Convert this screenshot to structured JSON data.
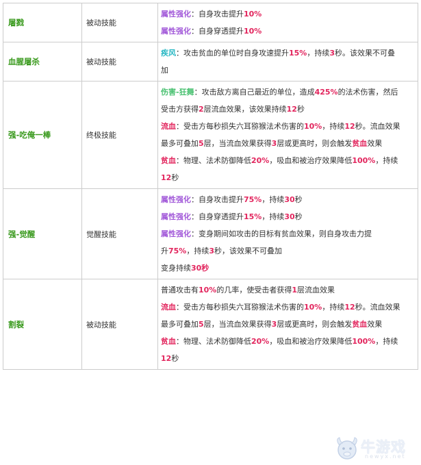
{
  "rows": [
    {
      "name": "屠戮",
      "type": "被动技能",
      "lines": [
        [
          {
            "t": "属性强化",
            "c": "k-purple"
          },
          {
            "t": "：自身攻击提升"
          },
          {
            "t": "10%",
            "c": "n"
          }
        ],
        [
          {
            "t": "属性强化",
            "c": "k-purple"
          },
          {
            "t": "：自身穿透提升"
          },
          {
            "t": "10%",
            "c": "n"
          }
        ]
      ]
    },
    {
      "name": "血腥屠杀",
      "type": "被动技能",
      "lines": [
        [
          {
            "t": "疾风",
            "c": "k-cyan"
          },
          {
            "t": "：攻击贫血的单位时自身攻速提升"
          },
          {
            "t": "15%",
            "c": "n"
          },
          {
            "t": "，持续"
          },
          {
            "t": "3",
            "c": "n"
          },
          {
            "t": "秒。该效果不可叠"
          }
        ],
        [
          {
            "t": "加"
          }
        ]
      ]
    },
    {
      "name": "强-吃俺一棒",
      "type": "终极技能",
      "lines": [
        [
          {
            "t": "伤害-狂舞",
            "c": "k-green"
          },
          {
            "t": "：攻击敌方离自己最近的单位，造成"
          },
          {
            "t": "425%",
            "c": "n"
          },
          {
            "t": "的法术伤害，然后"
          }
        ],
        [
          {
            "t": "受击方获得"
          },
          {
            "t": "2",
            "c": "n"
          },
          {
            "t": "层流血效果，该效果持续"
          },
          {
            "t": "12",
            "c": "n"
          },
          {
            "t": "秒"
          }
        ],
        [
          {
            "t": "流血",
            "c": "k-red"
          },
          {
            "t": "：受击方每秒损失六耳猕猴法术伤害的"
          },
          {
            "t": "10%",
            "c": "n"
          },
          {
            "t": "，持续"
          },
          {
            "t": "12",
            "c": "n"
          },
          {
            "t": "秒。流血效果"
          }
        ],
        [
          {
            "t": "最多可叠加"
          },
          {
            "t": "5",
            "c": "n"
          },
          {
            "t": "层，当流血效果获得"
          },
          {
            "t": "3",
            "c": "n"
          },
          {
            "t": "层或更高时，则会触发"
          },
          {
            "t": "贫血",
            "c": "k-red"
          },
          {
            "t": "效果"
          }
        ],
        [
          {
            "t": "贫血",
            "c": "k-red"
          },
          {
            "t": "：物理、法术防御降低"
          },
          {
            "t": "20%",
            "c": "n"
          },
          {
            "t": "，吸血和被治疗效果降低"
          },
          {
            "t": "100%",
            "c": "n"
          },
          {
            "t": "，持续"
          }
        ],
        [
          {
            "t": "12",
            "c": "n"
          },
          {
            "t": "秒"
          }
        ]
      ]
    },
    {
      "name": "强-觉醒",
      "type": "觉醒技能",
      "lines": [
        [
          {
            "t": "属性强化",
            "c": "k-purple"
          },
          {
            "t": "：自身攻击提升"
          },
          {
            "t": "75%",
            "c": "n"
          },
          {
            "t": "，持续"
          },
          {
            "t": "30",
            "c": "n"
          },
          {
            "t": "秒"
          }
        ],
        [
          {
            "t": "属性强化",
            "c": "k-purple"
          },
          {
            "t": "：自身穿透提升"
          },
          {
            "t": "15%",
            "c": "n"
          },
          {
            "t": "，持续"
          },
          {
            "t": "30",
            "c": "n"
          },
          {
            "t": "秒"
          }
        ],
        [
          {
            "t": "属性强化",
            "c": "k-purple"
          },
          {
            "t": "：变身期间如攻击的目标有贫血效果，则自身攻击力提"
          }
        ],
        [
          {
            "t": "升"
          },
          {
            "t": "75%",
            "c": "n"
          },
          {
            "t": "，持续"
          },
          {
            "t": "3",
            "c": "n"
          },
          {
            "t": "秒，该效果不可叠加"
          }
        ],
        [
          {
            "t": "变身持续"
          },
          {
            "t": "30秒",
            "c": "n"
          }
        ]
      ]
    },
    {
      "name": "割裂",
      "type": "被动技能",
      "lines": [
        [
          {
            "t": "普通攻击有"
          },
          {
            "t": "10%",
            "c": "n"
          },
          {
            "t": "的几率，使受击者获得"
          },
          {
            "t": "1",
            "c": "n"
          },
          {
            "t": "层流血效果"
          }
        ],
        [
          {
            "t": "流血",
            "c": "k-red"
          },
          {
            "t": "：受击方每秒损失六耳猕猴法术伤害的"
          },
          {
            "t": "10%",
            "c": "n"
          },
          {
            "t": "，持续"
          },
          {
            "t": "12",
            "c": "n"
          },
          {
            "t": "秒。流血效果"
          }
        ],
        [
          {
            "t": "最多可叠加"
          },
          {
            "t": "5",
            "c": "n"
          },
          {
            "t": "层，当流血效果获得"
          },
          {
            "t": "3",
            "c": "n"
          },
          {
            "t": "层或更高时，则会触发"
          },
          {
            "t": "贫血",
            "c": "k-red"
          },
          {
            "t": "效果"
          }
        ],
        [
          {
            "t": "贫血",
            "c": "k-red"
          },
          {
            "t": "：物理、法术防御降低"
          },
          {
            "t": "20%",
            "c": "n"
          },
          {
            "t": "，吸血和被治疗效果降低"
          },
          {
            "t": "100%",
            "c": "n"
          },
          {
            "t": "，持续"
          }
        ],
        [
          {
            "t": "12",
            "c": "n"
          },
          {
            "t": "秒"
          }
        ]
      ]
    }
  ],
  "watermark": {
    "text": "牛游戏",
    "sub": "newyx.net",
    "icon": "ox-mascot-icon"
  },
  "colors": {
    "name": "#3a9a1e",
    "purple": "#a259d9",
    "cyan": "#28b7c3",
    "green": "#47c06f",
    "red": "#e2255d",
    "border": "#cccccc"
  }
}
